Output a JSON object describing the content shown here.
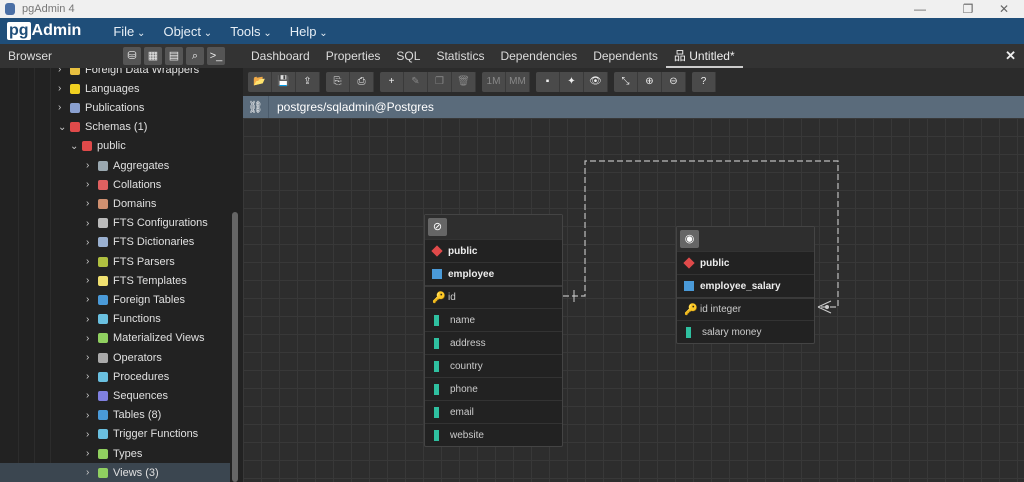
{
  "window": {
    "title": "pgAdmin 4",
    "controls": [
      "minimize",
      "restore",
      "close"
    ]
  },
  "menubar": {
    "brand_pg": "pg",
    "brand_admin": "Admin",
    "menus": [
      "File",
      "Object",
      "Tools",
      "Help"
    ]
  },
  "browser": {
    "title": "Browser",
    "tools": [
      "query-tool-icon",
      "table-icon",
      "filter-icon",
      "search-icon",
      "terminal-icon"
    ]
  },
  "tree": [
    {
      "label": "Foreign Data Wrappers",
      "level": 1,
      "icon": "#e8c040"
    },
    {
      "label": "Languages",
      "level": 1,
      "icon": "#f0d020"
    },
    {
      "label": "Publications",
      "level": 1,
      "icon": "#8aa0d0"
    },
    {
      "label": "Schemas (1)",
      "level": 1,
      "icon": "#e04a4a",
      "expanded": true
    },
    {
      "label": "public",
      "level": 2,
      "icon": "#e04a4a",
      "expanded": true
    },
    {
      "label": "Aggregates",
      "level": 3,
      "icon": "#9aa8b0"
    },
    {
      "label": "Collations",
      "level": 3,
      "icon": "#e06060"
    },
    {
      "label": "Domains",
      "level": 3,
      "icon": "#d09070"
    },
    {
      "label": "FTS Configurations",
      "level": 3,
      "icon": "#bbbbbb"
    },
    {
      "label": "FTS Dictionaries",
      "level": 3,
      "icon": "#9ab0d0"
    },
    {
      "label": "FTS Parsers",
      "level": 3,
      "icon": "#b0c040"
    },
    {
      "label": "FTS Templates",
      "level": 3,
      "icon": "#f0e070"
    },
    {
      "label": "Foreign Tables",
      "level": 3,
      "icon": "#4a9ad8"
    },
    {
      "label": "Functions",
      "level": 3,
      "icon": "#6ac0e0"
    },
    {
      "label": "Materialized Views",
      "level": 3,
      "icon": "#90d060"
    },
    {
      "label": "Operators",
      "level": 3,
      "icon": "#aaaaaa"
    },
    {
      "label": "Procedures",
      "level": 3,
      "icon": "#6ac0e0"
    },
    {
      "label": "Sequences",
      "level": 3,
      "icon": "#8080e0"
    },
    {
      "label": "Tables (8)",
      "level": 3,
      "icon": "#4a9ad8"
    },
    {
      "label": "Trigger Functions",
      "level": 3,
      "icon": "#6ac0e0"
    },
    {
      "label": "Types",
      "level": 3,
      "icon": "#90d060"
    },
    {
      "label": "Views (3)",
      "level": 3,
      "icon": "#90d060",
      "selected": true
    }
  ],
  "tabs": [
    "Dashboard",
    "Properties",
    "SQL",
    "Statistics",
    "Dependencies",
    "Dependents",
    "Untitled*"
  ],
  "active_tab": "Untitled*",
  "toolbar": {
    "groups": [
      [
        "📂",
        "💾",
        "⇪"
      ],
      [
        "⎘",
        "⎙"
      ],
      [
        "+",
        "✎",
        "❐",
        "🗑"
      ],
      [
        "1M",
        "MM"
      ],
      [
        "▪",
        "✦",
        "👁"
      ],
      [
        "⤡",
        "⊕",
        "⊖"
      ],
      [
        "?"
      ]
    ]
  },
  "connection": "postgres/sqladmin@Postgres",
  "erd": {
    "tables": [
      {
        "schema": "public",
        "name": "employee",
        "columns": [
          {
            "name": "id",
            "pk": true
          },
          {
            "name": "name"
          },
          {
            "name": "address"
          },
          {
            "name": "country"
          },
          {
            "name": "phone"
          },
          {
            "name": "email"
          },
          {
            "name": "website"
          }
        ],
        "details_hidden": true
      },
      {
        "schema": "public",
        "name": "employee_salary",
        "columns": [
          {
            "name": "id integer",
            "pk": true
          },
          {
            "name": "salary money"
          }
        ],
        "details_hidden": false
      }
    ],
    "relationship": {
      "from": "employee.id",
      "to": "employee_salary.id",
      "type": "one-to-many"
    }
  }
}
